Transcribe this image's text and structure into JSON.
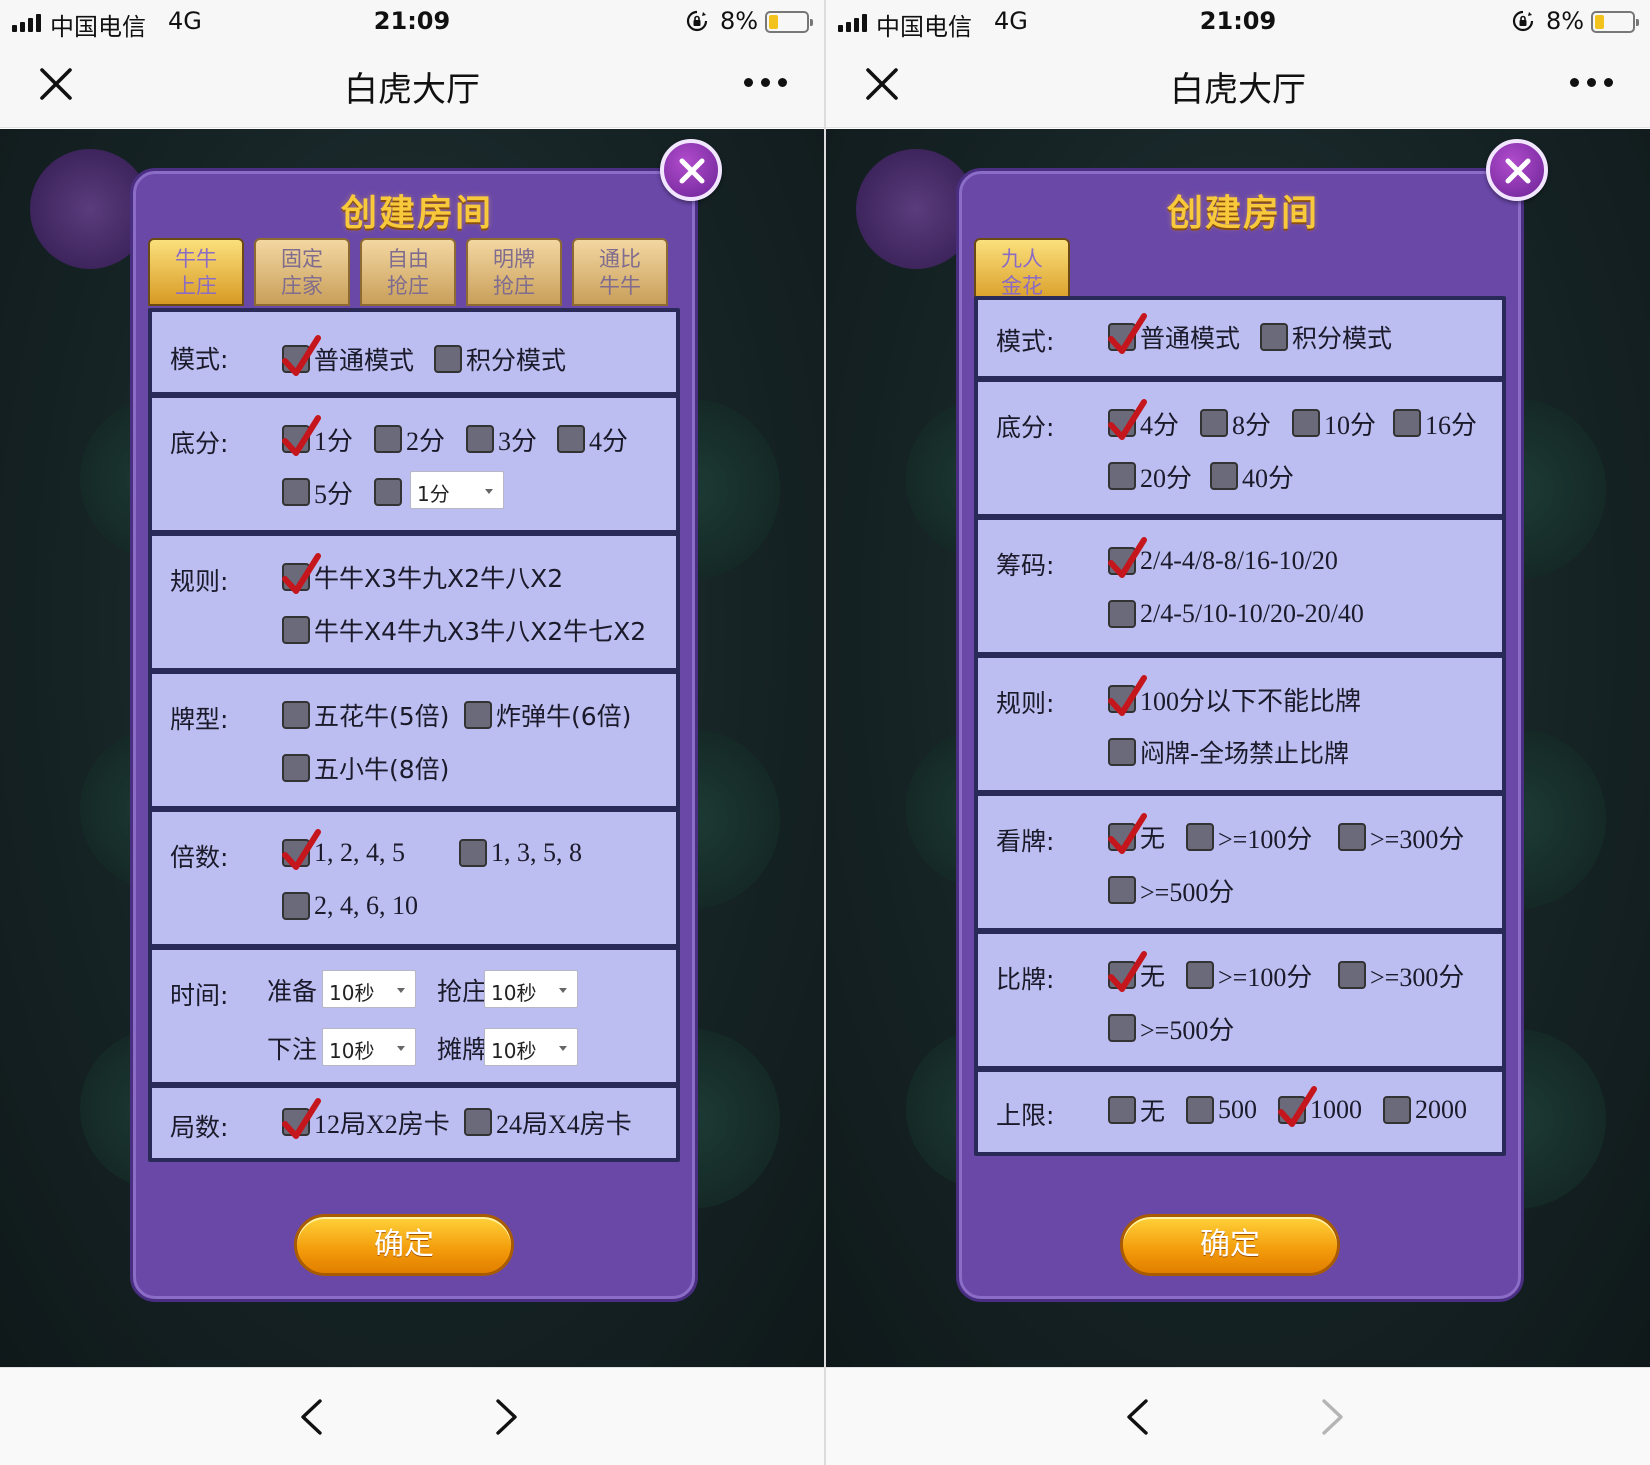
{
  "status_bar": {
    "carrier": "中国电信",
    "network": "4G",
    "time": "21:09",
    "battery_percent": "8%",
    "battery_level": 0.08
  },
  "nav": {
    "title": "白虎大厅"
  },
  "screens": [
    {
      "modal_title": "创建房间",
      "tabs": [
        {
          "label": "牛牛\n上庄",
          "active": true
        },
        {
          "label": "固定\n庄家",
          "active": false
        },
        {
          "label": "自由\n抢庄",
          "active": false
        },
        {
          "label": "明牌\n抢庄",
          "active": false
        },
        {
          "label": "通比\n牛牛",
          "active": false
        }
      ],
      "rows": [
        {
          "label": "模式:",
          "options": [
            {
              "text": "普通模式",
              "checked": true
            },
            {
              "text": "积分模式",
              "checked": false
            }
          ]
        },
        {
          "label": "底分:",
          "options": [
            {
              "text": "1分",
              "checked": true
            },
            {
              "text": "2分",
              "checked": false
            },
            {
              "text": "3分",
              "checked": false
            },
            {
              "text": "4分",
              "checked": false
            },
            {
              "text": "5分",
              "checked": false
            },
            {
              "text": "",
              "checked": false
            }
          ],
          "select_value": "1分"
        },
        {
          "label": "规则:",
          "options": [
            {
              "text": "牛牛X3牛九X2牛八X2",
              "checked": true
            },
            {
              "text": "牛牛X4牛九X3牛八X2牛七X2",
              "checked": false
            }
          ]
        },
        {
          "label": "牌型:",
          "options": [
            {
              "text": "五花牛(5倍)",
              "checked": false
            },
            {
              "text": "炸弹牛(6倍)",
              "checked": false
            },
            {
              "text": "五小牛(8倍)",
              "checked": false
            }
          ]
        },
        {
          "label": "倍数:",
          "options": [
            {
              "text": "1, 2, 4, 5",
              "checked": true
            },
            {
              "text": "1, 3, 5, 8",
              "checked": false
            },
            {
              "text": "2, 4, 6, 10",
              "checked": false
            }
          ]
        },
        {
          "label": "时间:",
          "times": [
            {
              "name": "准备",
              "value": "10秒"
            },
            {
              "name": "抢庄",
              "value": "10秒"
            },
            {
              "name": "下注",
              "value": "10秒"
            },
            {
              "name": "摊牌",
              "value": "10秒"
            }
          ]
        },
        {
          "label": "局数:",
          "options": [
            {
              "text": "12局X2房卡",
              "checked": true
            },
            {
              "text": "24局X4房卡",
              "checked": false
            }
          ]
        }
      ],
      "confirm_label": "确定",
      "forward_enabled": true
    },
    {
      "modal_title": "创建房间",
      "tabs": [
        {
          "label": "九人\n金花",
          "active": true
        }
      ],
      "rows": [
        {
          "label": "模式:",
          "options": [
            {
              "text": "普通模式",
              "checked": true
            },
            {
              "text": "积分模式",
              "checked": false
            }
          ]
        },
        {
          "label": "底分:",
          "options": [
            {
              "text": "4分",
              "checked": true
            },
            {
              "text": "8分",
              "checked": false
            },
            {
              "text": "10分",
              "checked": false
            },
            {
              "text": "16分",
              "checked": false
            },
            {
              "text": "20分",
              "checked": false
            },
            {
              "text": "40分",
              "checked": false
            }
          ]
        },
        {
          "label": "筹码:",
          "options": [
            {
              "text": "2/4-4/8-8/16-10/20",
              "checked": true
            },
            {
              "text": "2/4-5/10-10/20-20/40",
              "checked": false
            }
          ]
        },
        {
          "label": "规则:",
          "options": [
            {
              "text": "100分以下不能比牌",
              "checked": true
            },
            {
              "text": "闷牌-全场禁止比牌",
              "checked": false
            }
          ]
        },
        {
          "label": "看牌:",
          "options": [
            {
              "text": "无",
              "checked": true
            },
            {
              "text": ">=100分",
              "checked": false
            },
            {
              "text": ">=300分",
              "checked": false
            },
            {
              "text": ">=500分",
              "checked": false
            }
          ]
        },
        {
          "label": "比牌:",
          "options": [
            {
              "text": "无",
              "checked": true
            },
            {
              "text": ">=100分",
              "checked": false
            },
            {
              "text": ">=300分",
              "checked": false
            },
            {
              "text": ">=500分",
              "checked": false
            }
          ]
        },
        {
          "label": "上限:",
          "options": [
            {
              "text": "无",
              "checked": false
            },
            {
              "text": "500",
              "checked": false
            },
            {
              "text": "1000",
              "checked": true
            },
            {
              "text": "2000",
              "checked": false
            }
          ]
        }
      ],
      "confirm_label": "确定",
      "forward_enabled": false
    }
  ],
  "colors": {
    "modal_bg": "#6a48a8",
    "panel_bg": "#bcbdf0",
    "title_gold": "#f9c93c",
    "check_red": "#c4161c",
    "confirm_orange": "#f39a0a"
  },
  "icons": {
    "close": "close-icon",
    "more": "more-icon",
    "back": "chevron-left-icon",
    "forward": "chevron-right-icon",
    "check": "checkmark-icon",
    "lock": "rotation-lock-icon"
  }
}
